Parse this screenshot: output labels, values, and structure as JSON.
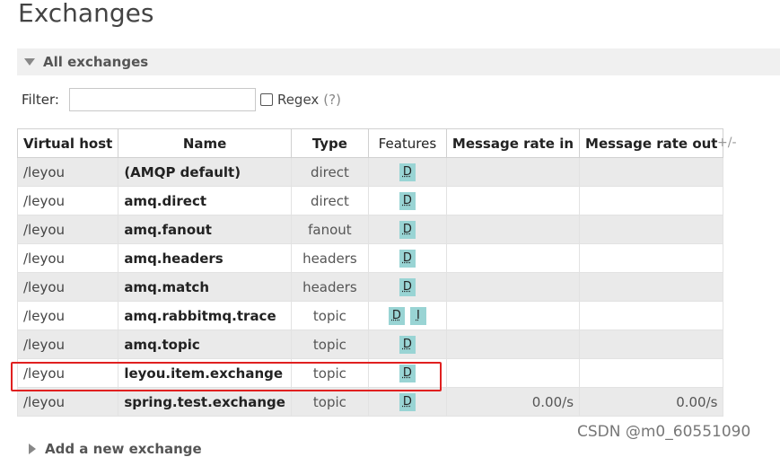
{
  "page": {
    "title": "Exchanges"
  },
  "section": {
    "label": "All exchanges"
  },
  "filter": {
    "label": "Filter:",
    "value": "",
    "placeholder": "",
    "regex_label": "Regex",
    "regex_help": "(?)"
  },
  "table": {
    "headers": [
      "Virtual host",
      "Name",
      "Type",
      "Features",
      "Message rate in",
      "Message rate out"
    ],
    "plus_minus": "+/-",
    "rows": [
      {
        "vhost": "/leyou",
        "name": "(AMQP default)",
        "type": "direct",
        "features": [
          "D"
        ],
        "rate_in": "",
        "rate_out": ""
      },
      {
        "vhost": "/leyou",
        "name": "amq.direct",
        "type": "direct",
        "features": [
          "D"
        ],
        "rate_in": "",
        "rate_out": ""
      },
      {
        "vhost": "/leyou",
        "name": "amq.fanout",
        "type": "fanout",
        "features": [
          "D"
        ],
        "rate_in": "",
        "rate_out": ""
      },
      {
        "vhost": "/leyou",
        "name": "amq.headers",
        "type": "headers",
        "features": [
          "D"
        ],
        "rate_in": "",
        "rate_out": ""
      },
      {
        "vhost": "/leyou",
        "name": "amq.match",
        "type": "headers",
        "features": [
          "D"
        ],
        "rate_in": "",
        "rate_out": ""
      },
      {
        "vhost": "/leyou",
        "name": "amq.rabbitmq.trace",
        "type": "topic",
        "features": [
          "D",
          "I"
        ],
        "rate_in": "",
        "rate_out": ""
      },
      {
        "vhost": "/leyou",
        "name": "amq.topic",
        "type": "topic",
        "features": [
          "D"
        ],
        "rate_in": "",
        "rate_out": ""
      },
      {
        "vhost": "/leyou",
        "name": "leyou.item.exchange",
        "type": "topic",
        "features": [
          "D"
        ],
        "rate_in": "",
        "rate_out": ""
      },
      {
        "vhost": "/leyou",
        "name": "spring.test.exchange",
        "type": "topic",
        "features": [
          "D"
        ],
        "rate_in": "0.00/s",
        "rate_out": "0.00/s"
      }
    ]
  },
  "add_section": {
    "label": "Add a new exchange"
  },
  "watermark": "CSDN @m0_60551090",
  "colors": {
    "feature_tag": "#99d4d4",
    "highlight": "#e02020",
    "alt_row": "#eaeaea"
  }
}
